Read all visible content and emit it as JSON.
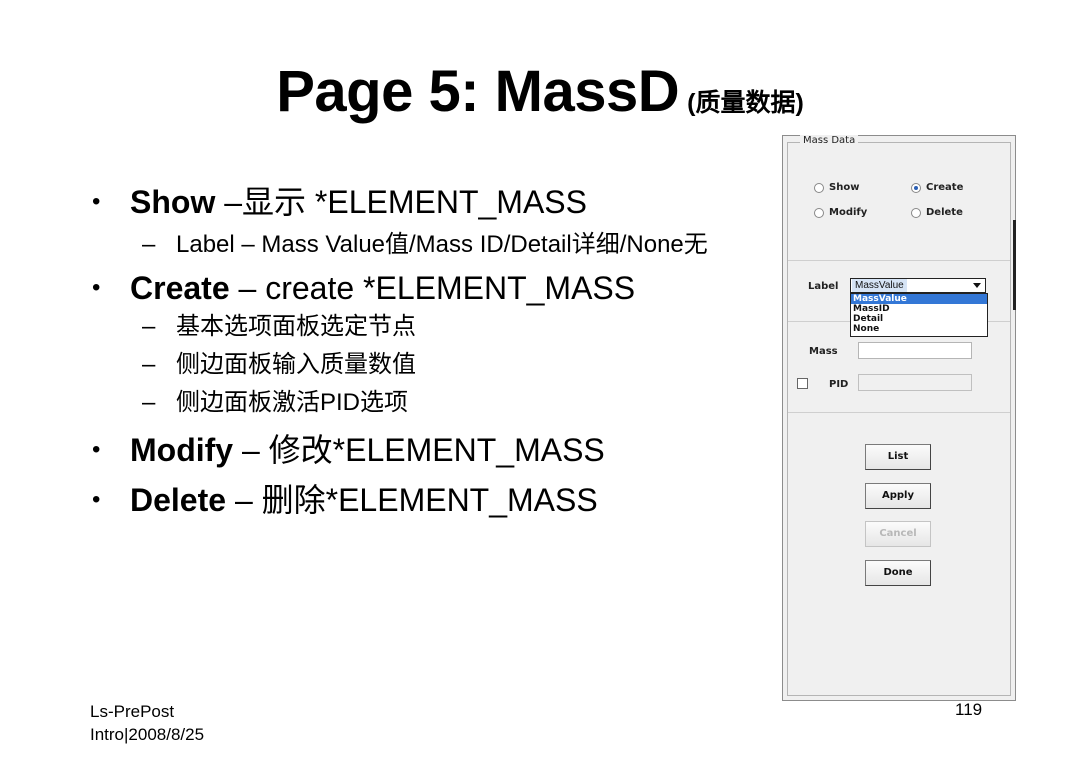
{
  "title": {
    "main": "Page 5: MassD",
    "sub": "(质量数据)"
  },
  "bullets": {
    "show": {
      "name": "Show",
      "text": " –显示 *ELEMENT_MASS"
    },
    "show_sub": "Label – Mass Value值/Mass ID/Detail详细/None无",
    "create": {
      "name": "Create",
      "text": " – create *ELEMENT_MASS"
    },
    "create_subs": [
      "基本选项面板选定节点",
      "侧边面板输入质量数值",
      "侧边面板激活PID选项"
    ],
    "modify": {
      "name": "Modify",
      "text": " – 修改*ELEMENT_MASS"
    },
    "delete": {
      "name": "Delete",
      "text": " – 删除*ELEMENT_MASS"
    }
  },
  "footer": {
    "source_line1": "Ls-PrePost",
    "source_line2": "Intro|2008/8/25",
    "page_number": "119"
  },
  "panel": {
    "group_title": "Mass Data",
    "radios": [
      {
        "label": "Show",
        "selected": false
      },
      {
        "label": "Create",
        "selected": true
      },
      {
        "label": "Modify",
        "selected": false
      },
      {
        "label": "Delete",
        "selected": false
      }
    ],
    "label_field": "Label",
    "dropdown_value": "MassValue",
    "dropdown_options": [
      "MassValue",
      "MassID",
      "Detail",
      "None"
    ],
    "mass_label": "Mass",
    "mass_value": "",
    "pid_label": "PID",
    "pid_value": "",
    "buttons": {
      "list": "List",
      "apply": "Apply",
      "cancel": "Cancel",
      "done": "Done"
    }
  }
}
